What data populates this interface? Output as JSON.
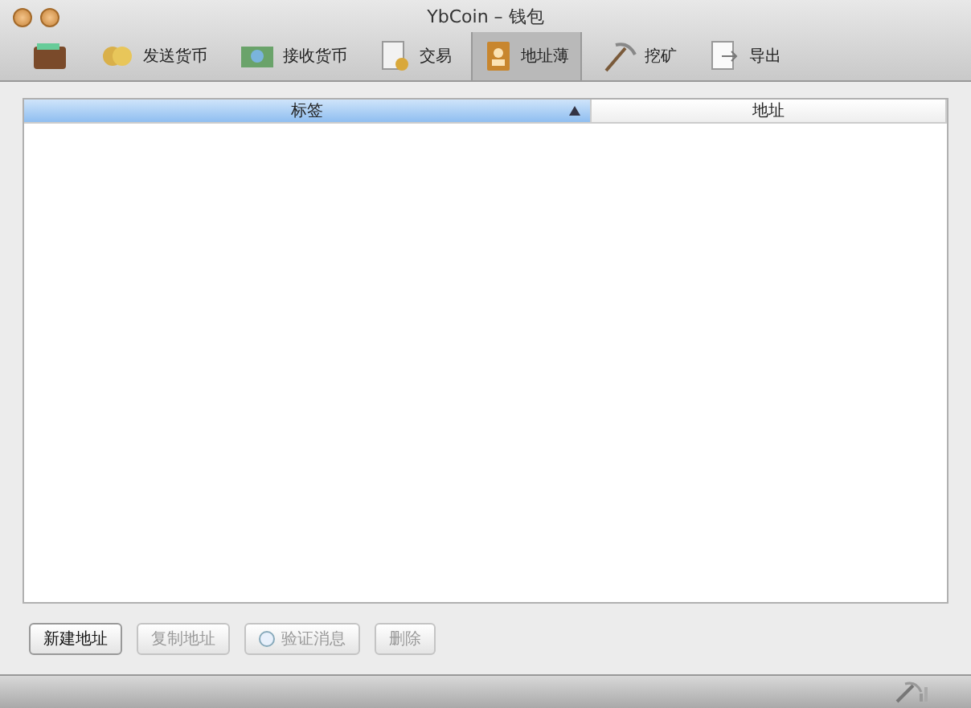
{
  "window": {
    "title": "YbCoin – 钱包"
  },
  "toolbar": [
    {
      "selected": false
    },
    {
      "label": "发送货币",
      "selected": false
    },
    {
      "label": "接收货币",
      "selected": false
    },
    {
      "label": "交易",
      "selected": false
    },
    {
      "label": "地址薄",
      "selected": true
    },
    {
      "label": "挖矿",
      "selected": false
    },
    {
      "label": "导出",
      "selected": false
    }
  ],
  "table": {
    "columns": [
      {
        "label": "标签",
        "sorted": true
      },
      {
        "label": "地址",
        "sorted": false
      }
    ]
  },
  "buttons": [
    {
      "label": "新建地址",
      "disabled": false
    },
    {
      "label": "复制地址",
      "disabled": true
    },
    {
      "label": "验证消息",
      "disabled": true
    },
    {
      "label": "删除",
      "disabled": true
    }
  ]
}
